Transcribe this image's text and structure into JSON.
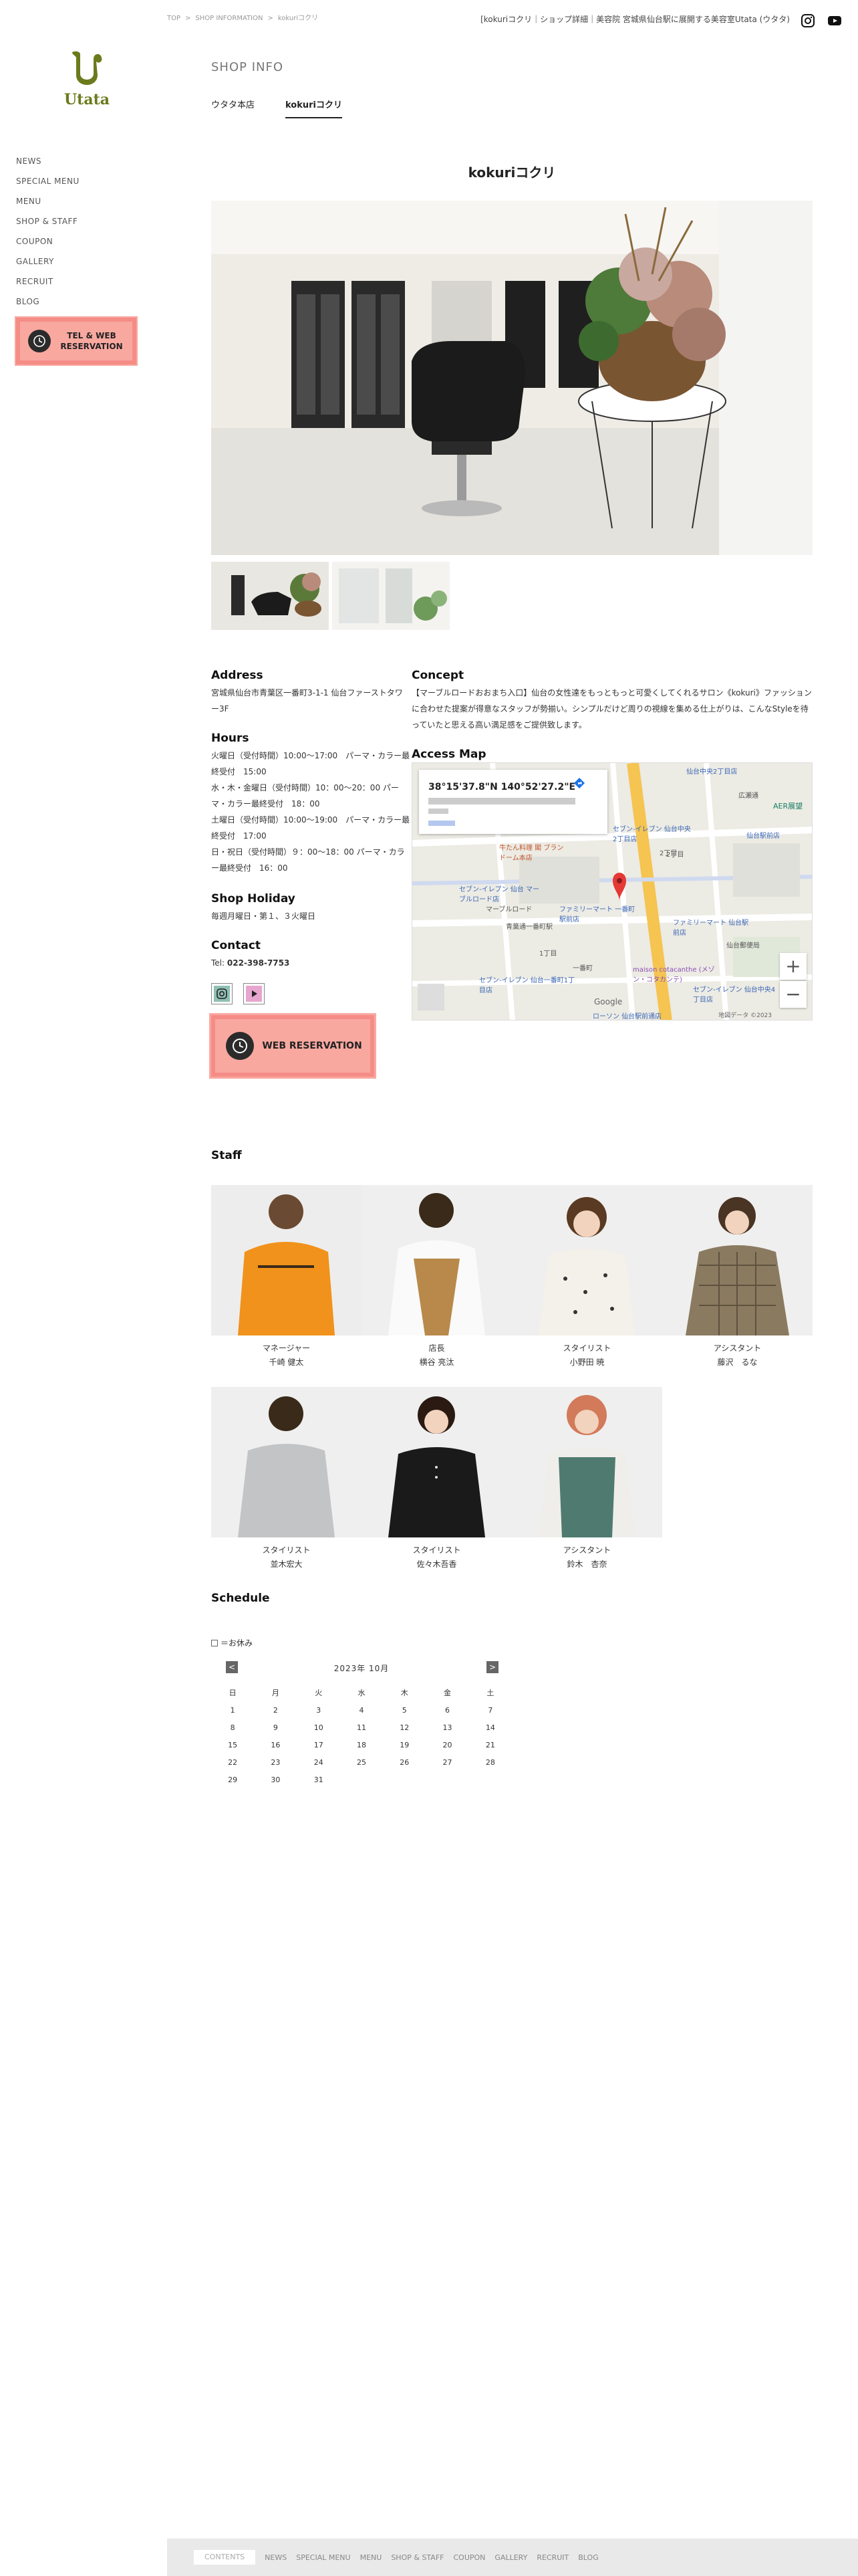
{
  "brand": {
    "logo_text": "Utata",
    "brand_color": "#6c7a1d"
  },
  "sidebar": {
    "items": [
      "NEWS",
      "SPECIAL MENU",
      "MENU",
      "SHOP & STAFF",
      "COUPON",
      "GALLERY",
      "RECRUIT",
      "BLOG"
    ],
    "tel_web_line1": "TEL & WEB",
    "tel_web_line2": "RESERVATION"
  },
  "breadcrumb": {
    "items": [
      "TOP",
      "SHOP INFORMATION",
      "kokuriコクリ"
    ],
    "separator": ">"
  },
  "header": {
    "title": "[kokuriコクリ｜ショップ詳細｜美容院 宮城県仙台駅に展開する美容室Utata (ウタタ)"
  },
  "page": {
    "heading": "SHOP INFO",
    "tabs": [
      {
        "label": "ウタタ本店",
        "active": false
      },
      {
        "label": "kokuriコクリ",
        "active": true
      }
    ],
    "shop_name": "kokuriコクリ"
  },
  "address": {
    "heading": "Address",
    "text": "宮城県仙台市青葉区一番町3-1-1 仙台ファーストタワー3F"
  },
  "concept": {
    "heading": "Concept",
    "text": "【マーブルロードおおまち入口】仙台の女性達をもっともっと可愛くしてくれるサロン《kokuri》ファッションに合わせた提案が得意なスタッフが勢揃い。シンプルだけど周りの視線を集める仕上がりは、こんなStyleを待っていたと思える高い満足感をご提供致します。"
  },
  "hours": {
    "heading": "Hours",
    "lines": [
      "火曜日（受付時間）10:00〜17:00　パーマ・カラー最終受付　15:00",
      "水・木・金曜日（受付時間）10：00〜20：00 パーマ・カラー最終受付　18：00",
      "土曜日（受付時間）10:00〜19:00　パーマ・カラー最終受付　17:00",
      "日・祝日（受付時間）９：00〜18：00 パーマ・カラー最終受付　16：00"
    ]
  },
  "holiday": {
    "heading": "Shop Holiday",
    "text": "毎週月曜日・第１、３火曜日"
  },
  "contact": {
    "heading": "Contact",
    "tel_label": "Tel:",
    "tel": "022-398-7753"
  },
  "map": {
    "heading": "Access Map",
    "coord": "38°15'37.8\"N 140°52'27.2\"E",
    "zoom_in": "+",
    "zoom_out": "−",
    "labels": [
      "仙台中央2丁目店",
      "広瀬通",
      "AER展望",
      "セブン-イレブン 仙台中央2丁目店",
      "2丁目",
      "ファミリーマート 仙台駅前店",
      "仙台駅前店",
      "セブン-イレブン 仙台 マーブルロード店",
      "マーブルロード",
      "青葉通一番町駅",
      "ファミリーマート 一番町駅前店",
      "仙台郵便局",
      "セブン-イレブン 仙台一番町1丁目店",
      "一番町",
      "maison cotacanthe (メゾン・コタカンテ)",
      "セブン-イレブン 仙台中央4丁目店",
      "ローソン 仙台駅前通店",
      "1丁目",
      "2丁目",
      "牛たん料理 閣 ブランドーム本店",
      "Google",
      "地図データ ©2023"
    ]
  },
  "reservation": {
    "label": "WEB RESERVATION"
  },
  "staff": {
    "heading": "Staff",
    "members": [
      {
        "role": "マネージャー",
        "name": "千崎 健太"
      },
      {
        "role": "店長",
        "name": "横谷 亮汰"
      },
      {
        "role": "スタイリスト",
        "name": "小野田 暁"
      },
      {
        "role": "アシスタント",
        "name": "藤沢　るな"
      },
      {
        "role": "スタイリスト",
        "name": "並木宏大"
      },
      {
        "role": "スタイリスト",
        "name": "佐々木吾香"
      },
      {
        "role": "アシスタント",
        "name": "鈴木　杏奈"
      }
    ]
  },
  "schedule": {
    "heading": "Schedule",
    "legend": "＝お休み",
    "month_title": "2023年 10月",
    "prev": "<",
    "next": ">",
    "weekdays": [
      "日",
      "月",
      "火",
      "水",
      "木",
      "金",
      "土"
    ],
    "weeks": [
      [
        "1",
        "2",
        "3",
        "4",
        "5",
        "6",
        "7"
      ],
      [
        "8",
        "9",
        "10",
        "11",
        "12",
        "13",
        "14"
      ],
      [
        "15",
        "16",
        "17",
        "18",
        "19",
        "20",
        "21"
      ],
      [
        "22",
        "23",
        "24",
        "25",
        "26",
        "27",
        "28"
      ],
      [
        "29",
        "30",
        "31",
        "",
        "",
        "",
        ""
      ]
    ]
  },
  "footer": {
    "contents_label": "CONTENTS",
    "links": [
      "NEWS",
      "SPECIAL MENU",
      "MENU",
      "SHOP & STAFF",
      "COUPON",
      "GALLERY",
      "RECRUIT",
      "BLOG"
    ]
  },
  "colors": {
    "reservation_bg": "#f9a8a0",
    "reservation_border": "#f58c86",
    "instagram_bg": "#8fbfb3",
    "youtube_bg": "#e7a6cf"
  }
}
